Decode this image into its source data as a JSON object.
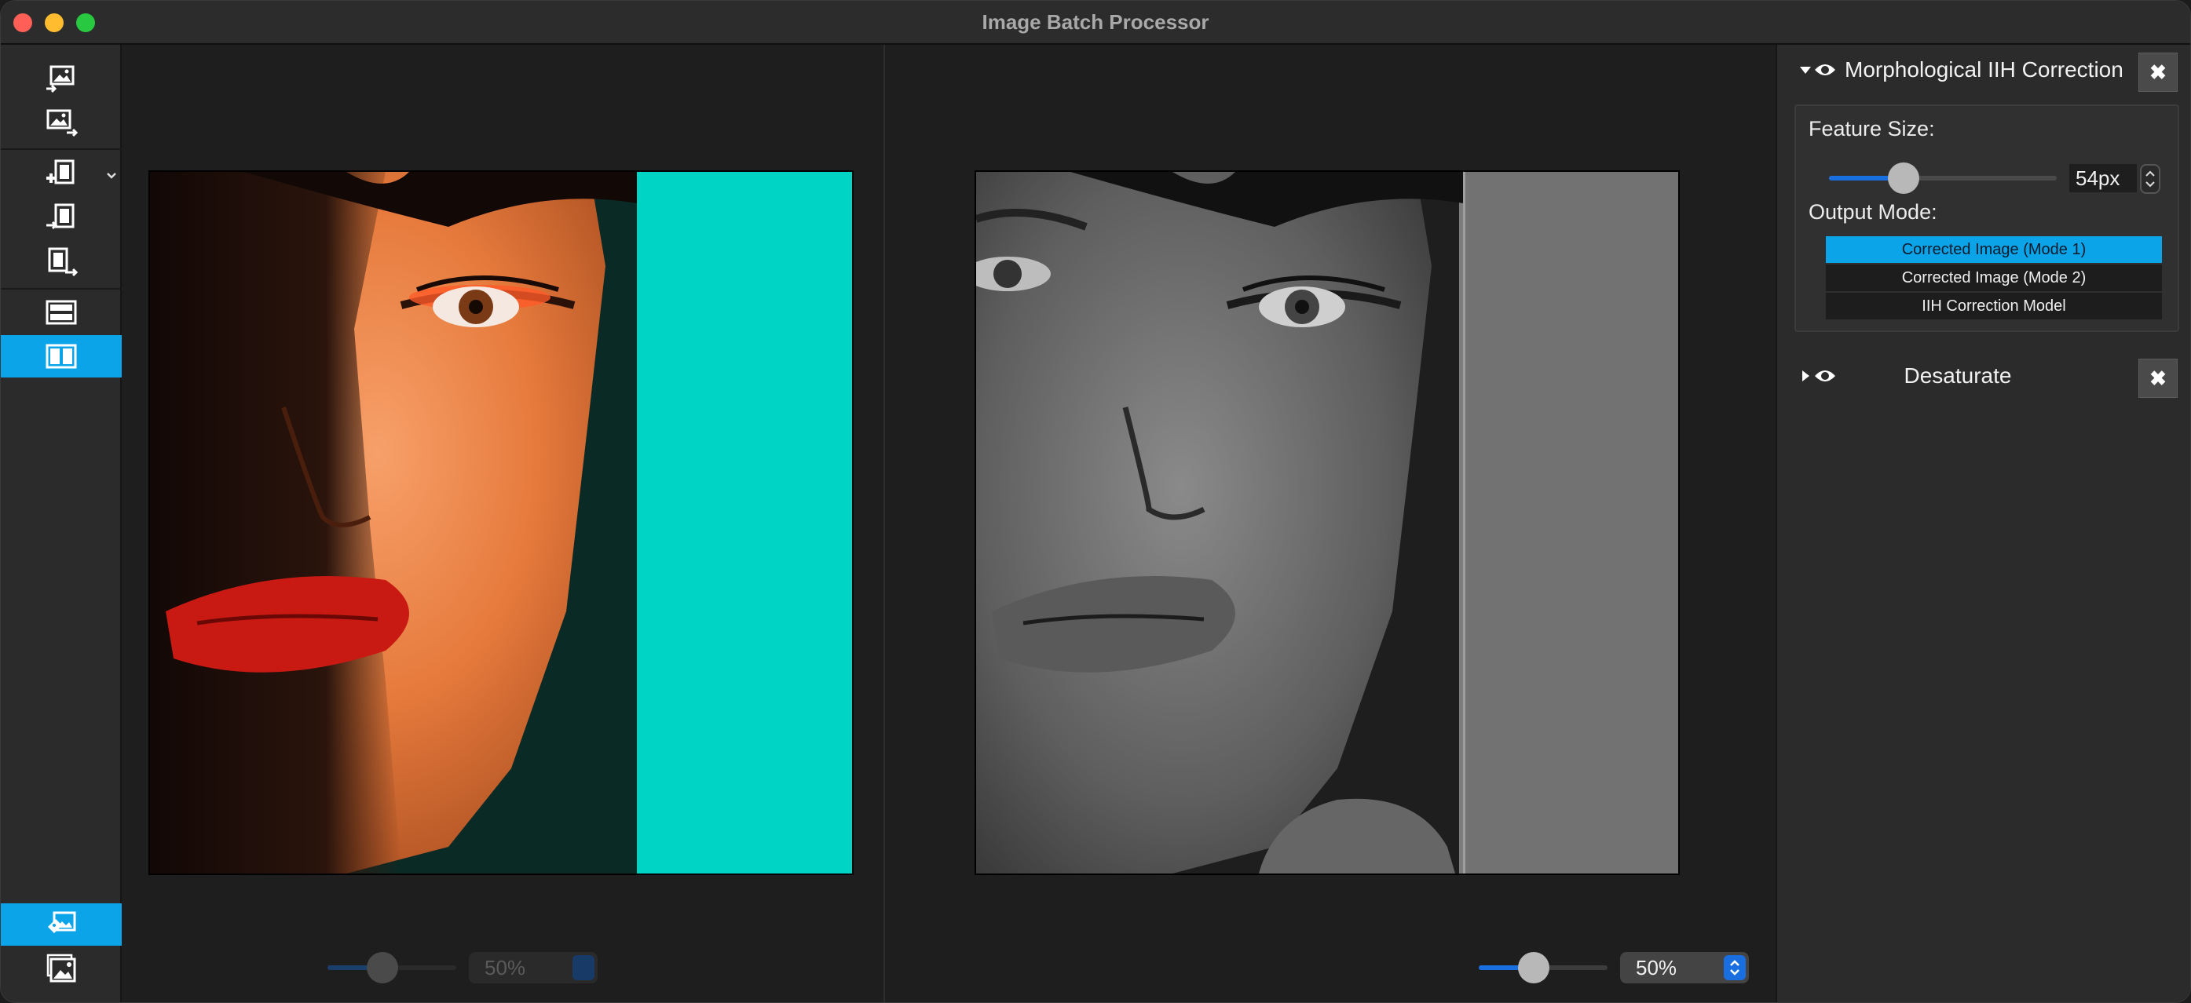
{
  "window": {
    "title": "Image Batch Processor"
  },
  "toolbar": {
    "tools": [
      {
        "name": "import-images",
        "active": false
      },
      {
        "name": "export-images",
        "active": false
      },
      {
        "name": "add-layer",
        "active": false,
        "has_menu": true
      },
      {
        "name": "import-layer",
        "active": false
      },
      {
        "name": "export-layer",
        "active": false
      },
      {
        "name": "view-stacked",
        "active": false
      },
      {
        "name": "view-side-by-side",
        "active": true
      },
      {
        "name": "tag-batch",
        "active": true
      },
      {
        "name": "image-gallery",
        "active": false
      }
    ]
  },
  "left_view": {
    "zoom_value": "50%",
    "zoom_level": 0.4,
    "enabled": false
  },
  "right_view": {
    "zoom_value": "50%",
    "zoom_level": 0.4,
    "enabled": true
  },
  "effects": [
    {
      "title": "Morphological IIH Correction",
      "expanded": true,
      "visible": true,
      "close_label": "✖",
      "feature_size_label": "Feature Size:",
      "feature_size_value": "54px",
      "feature_size_level": 0.3,
      "output_mode_label": "Output Mode:",
      "output_modes": [
        {
          "label": "Corrected Image (Mode 1)",
          "selected": true
        },
        {
          "label": "Corrected Image (Mode 2)",
          "selected": false
        },
        {
          "label": "IIH Correction Model",
          "selected": false
        }
      ]
    },
    {
      "title": "Desaturate",
      "expanded": false,
      "visible": true,
      "close_label": "✖"
    }
  ],
  "colors": {
    "accent": "#0ca4e8",
    "slider_blue": "#1a6fe0",
    "teal_background": "#00d4c4"
  },
  "icons": [
    "chevron-down-icon",
    "eye-icon",
    "disclosure-triangle-icon",
    "close-icon"
  ]
}
